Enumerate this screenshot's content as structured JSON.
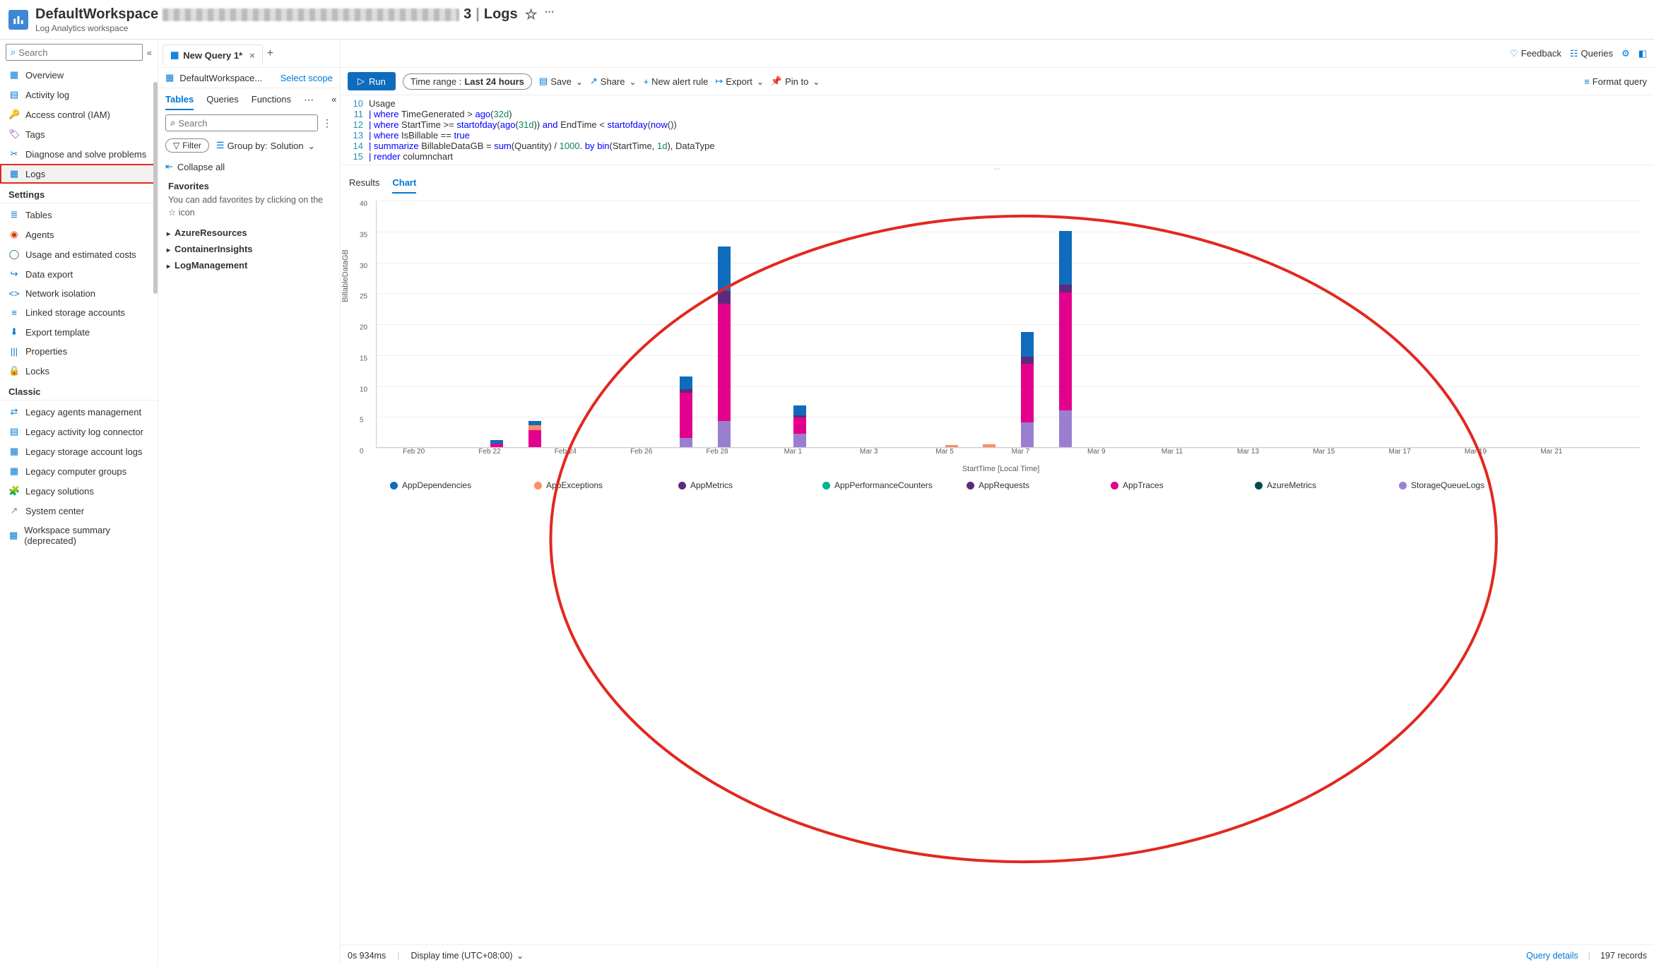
{
  "header": {
    "title_prefix": "DefaultWorkspace",
    "title_suffix": "3",
    "title_separator": "|",
    "title_page": "Logs",
    "subtitle": "Log Analytics workspace"
  },
  "leftnav": {
    "search_placeholder": "Search",
    "items_top": [
      {
        "label": "Overview",
        "icon": "overview"
      },
      {
        "label": "Activity log",
        "icon": "activity"
      },
      {
        "label": "Access control (IAM)",
        "icon": "iam"
      },
      {
        "label": "Tags",
        "icon": "tags"
      },
      {
        "label": "Diagnose and solve problems",
        "icon": "diagnose"
      },
      {
        "label": "Logs",
        "icon": "logs",
        "selected": true
      }
    ],
    "section_settings": "Settings",
    "items_settings": [
      {
        "label": "Tables",
        "icon": "tables"
      },
      {
        "label": "Agents",
        "icon": "agents"
      },
      {
        "label": "Usage and estimated costs",
        "icon": "usage"
      },
      {
        "label": "Data export",
        "icon": "dataexport"
      },
      {
        "label": "Network isolation",
        "icon": "network"
      },
      {
        "label": "Linked storage accounts",
        "icon": "linked"
      },
      {
        "label": "Export template",
        "icon": "exporttpl"
      },
      {
        "label": "Properties",
        "icon": "props"
      },
      {
        "label": "Locks",
        "icon": "locks"
      }
    ],
    "section_classic": "Classic",
    "items_classic": [
      {
        "label": "Legacy agents management",
        "icon": "legacyagents"
      },
      {
        "label": "Legacy activity log connector",
        "icon": "legacyactivity"
      },
      {
        "label": "Legacy storage account logs",
        "icon": "legacystorage"
      },
      {
        "label": "Legacy computer groups",
        "icon": "legacygroups"
      },
      {
        "label": "Legacy solutions",
        "icon": "legacysolutions"
      },
      {
        "label": "System center",
        "icon": "systemcenter"
      },
      {
        "label": "Workspace summary (deprecated)",
        "icon": "wssummary"
      }
    ]
  },
  "querytab": {
    "tab_label": "New Query 1*",
    "scope_name": "DefaultWorkspace...",
    "scope_select": "Select scope",
    "tabs": {
      "tables": "Tables",
      "queries": "Queries",
      "functions": "Functions"
    },
    "search_placeholder": "Search",
    "filter": "Filter",
    "groupby_label": "Group by:",
    "groupby_value": "Solution",
    "collapse_all": "Collapse all",
    "favorites_header": "Favorites",
    "favorites_text": "You can add favorites by clicking on the ☆ icon",
    "tree": [
      "AzureResources",
      "ContainerInsights",
      "LogManagement"
    ]
  },
  "toolbar": {
    "run": "Run",
    "timerange_label": "Time range :",
    "timerange_value": "Last 24 hours",
    "save": "Save",
    "share": "Share",
    "new_alert": "New alert rule",
    "export": "Export",
    "pin_to": "Pin to",
    "format_query": "Format query",
    "feedback": "Feedback",
    "queries": "Queries"
  },
  "editor": {
    "start_line": 10,
    "lines": [
      "Usage",
      "| where TimeGenerated > ago(32d)",
      "| where StartTime >= startofday(ago(31d)) and EndTime < startofday(now())",
      "| where IsBillable == true",
      "| summarize BillableDataGB = sum(Quantity) / 1000. by bin(StartTime, 1d), DataType",
      "| render columnchart"
    ]
  },
  "results": {
    "tabs": {
      "results": "Results",
      "chart": "Chart"
    }
  },
  "chart_data": {
    "type": "bar",
    "title": "",
    "xlabel": "StartTime [Local Time]",
    "ylabel": "BillableDataGB",
    "ylim": [
      0,
      40
    ],
    "yticks": [
      0,
      5,
      10,
      15,
      20,
      25,
      30,
      35,
      40
    ],
    "categories": [
      "Feb 20",
      "Feb 22",
      "Feb 24",
      "Feb 26",
      "Feb 28",
      "Mar 1",
      "Mar 3",
      "Mar 5",
      "Mar 7",
      "Mar 9",
      "Mar 11",
      "Mar 13",
      "Mar 15",
      "Mar 17",
      "Mar 19",
      "Mar 21"
    ],
    "series_colors": {
      "AppDependencies": "#0f6cbd",
      "AppExceptions": "#ff8b67",
      "AppMetrics": "#5e2a7e",
      "AppPerformanceCounters": "#00b294",
      "AppRequests": "#5e2a7e",
      "AppTraces": "#e3008c",
      "AzureMetrics": "#004b50",
      "StorageQueueLogs": "#9a7fd1"
    },
    "legend_order": [
      "AppDependencies",
      "AppExceptions",
      "AppMetrics",
      "AppPerformanceCounters",
      "AppRequests",
      "AppTraces",
      "AzureMetrics",
      "StorageQueueLogs"
    ],
    "bars": [
      {
        "x": "Feb 22",
        "stack": [
          {
            "s": "AppTraces",
            "v": 0.6
          },
          {
            "s": "AppDependencies",
            "v": 0.5
          }
        ]
      },
      {
        "x": "Feb 23",
        "stack": [
          {
            "s": "AppTraces",
            "v": 2.8
          },
          {
            "s": "AppExceptions",
            "v": 0.8
          },
          {
            "s": "AppDependencies",
            "v": 0.6
          }
        ]
      },
      {
        "x": "Feb 27",
        "stack": [
          {
            "s": "StorageQueueLogs",
            "v": 1.5
          },
          {
            "s": "AppTraces",
            "v": 7.3
          },
          {
            "s": "AppRequests",
            "v": 0.6
          },
          {
            "s": "AppDependencies",
            "v": 2.0
          }
        ]
      },
      {
        "x": "Feb 28",
        "stack": [
          {
            "s": "StorageQueueLogs",
            "v": 4.2
          },
          {
            "s": "AppTraces",
            "v": 19.0
          },
          {
            "s": "AppRequests",
            "v": 1.5
          },
          {
            "s": "AppMetrics",
            "v": 0.6
          },
          {
            "s": "AppDependencies",
            "v": 7.2
          }
        ]
      },
      {
        "x": "Mar 1",
        "stack": [
          {
            "s": "StorageQueueLogs",
            "v": 2.2
          },
          {
            "s": "AppTraces",
            "v": 2.6
          },
          {
            "s": "AppRequests",
            "v": 0.4
          },
          {
            "s": "AppDependencies",
            "v": 1.5
          }
        ]
      },
      {
        "x": "Mar 5",
        "stack": [
          {
            "s": "AppExceptions",
            "v": 0.3
          }
        ]
      },
      {
        "x": "Mar 6",
        "stack": [
          {
            "s": "AppExceptions",
            "v": 0.5
          }
        ]
      },
      {
        "x": "Mar 7",
        "stack": [
          {
            "s": "StorageQueueLogs",
            "v": 4.0
          },
          {
            "s": "AppTraces",
            "v": 9.5
          },
          {
            "s": "AppRequests",
            "v": 0.6
          },
          {
            "s": "AppMetrics",
            "v": 0.5
          },
          {
            "s": "AppDependencies",
            "v": 4.0
          }
        ]
      },
      {
        "x": "Mar 8",
        "stack": [
          {
            "s": "StorageQueueLogs",
            "v": 6.0
          },
          {
            "s": "AppTraces",
            "v": 19.0
          },
          {
            "s": "AppRequests",
            "v": 0.8
          },
          {
            "s": "AppMetrics",
            "v": 0.5
          },
          {
            "s": "AppDependencies",
            "v": 8.7
          }
        ]
      }
    ]
  },
  "statusbar": {
    "duration": "0s 934ms",
    "display_time_label": "Display time (UTC+08:00)",
    "query_details": "Query details",
    "records": "197 records"
  }
}
